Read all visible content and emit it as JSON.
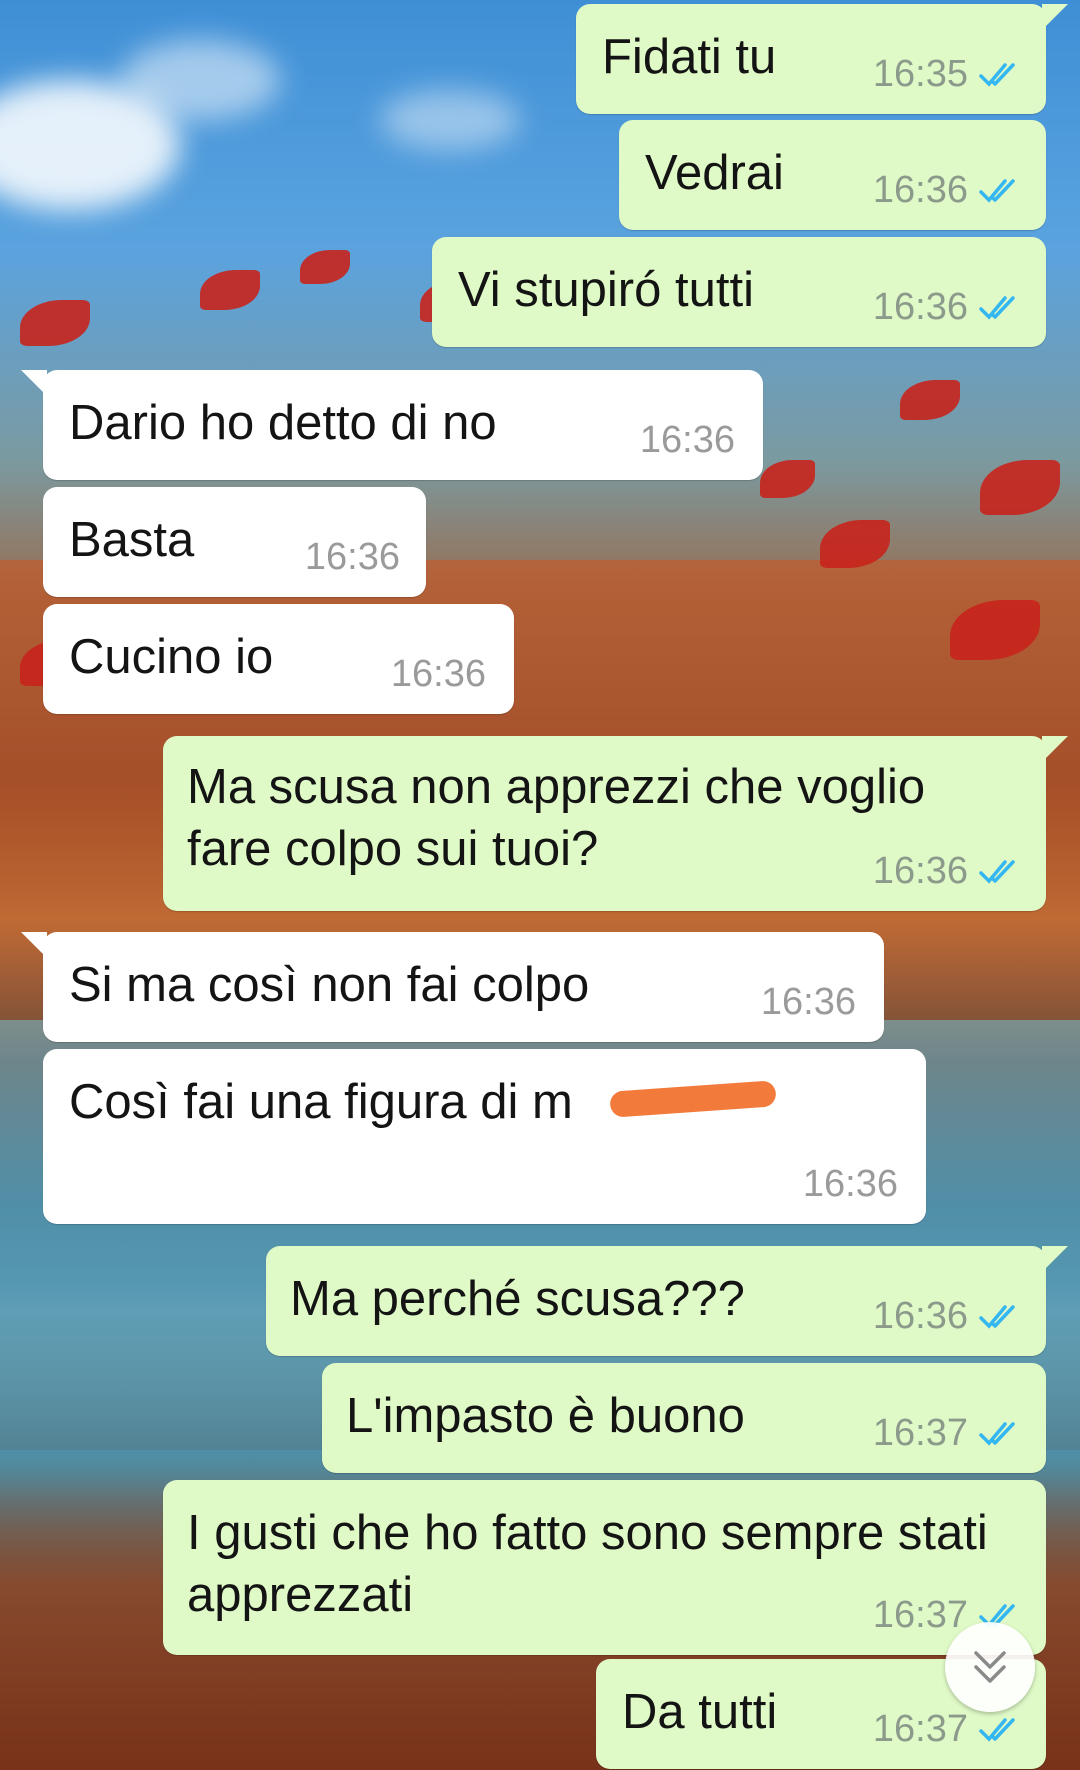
{
  "messages": [
    {
      "direction": "out",
      "text": "Fidati tu",
      "time": "16:35",
      "status": "read"
    },
    {
      "direction": "out",
      "text": "Vedrai",
      "time": "16:36",
      "status": "read"
    },
    {
      "direction": "out",
      "text": "Vi stupiró tutti",
      "time": "16:36",
      "status": "read"
    },
    {
      "direction": "in",
      "text": "Dario ho detto di no",
      "time": "16:36"
    },
    {
      "direction": "in",
      "text": "Basta",
      "time": "16:36"
    },
    {
      "direction": "in",
      "text": "Cucino io",
      "time": "16:36"
    },
    {
      "direction": "out",
      "text": "Ma scusa non apprezzi che voglio fare colpo sui tuoi?",
      "time": "16:36",
      "status": "read"
    },
    {
      "direction": "in",
      "text": "Si ma così non fai colpo",
      "time": "16:36"
    },
    {
      "direction": "in",
      "text": "Così fai una figura di m",
      "time": "16:36",
      "note": "last word covered by an orange scribble"
    },
    {
      "direction": "out",
      "text": "Ma perché scusa???",
      "time": "16:36",
      "status": "read"
    },
    {
      "direction": "out",
      "text": "L'impasto è buono",
      "time": "16:37",
      "status": "read"
    },
    {
      "direction": "out",
      "text": "I gusti che ho fatto sono sempre stati apprezzati",
      "time": "16:37",
      "status": "read"
    },
    {
      "direction": "out",
      "text": "Da tutti",
      "time": "16:37",
      "status": "read"
    }
  ],
  "icons": {
    "read_ticks": "double-check-icon",
    "scroll_down": "chevron-double-down-icon"
  },
  "colors": {
    "outgoing_bubble": "#e0fac7",
    "incoming_bubble": "#ffffff",
    "read_tick": "#34b7f1",
    "scribble": "#f27a3a"
  }
}
